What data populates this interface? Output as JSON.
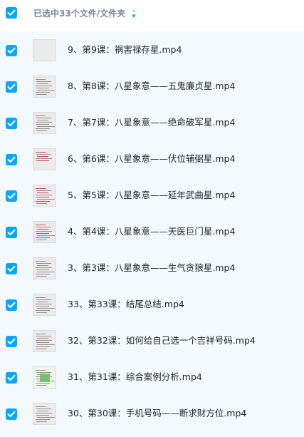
{
  "header": {
    "selected_text": "已选中33个文件/文件夹",
    "sort_icon": "sort-icon",
    "select_all_checked": true
  },
  "colors": {
    "accent": "#06a7ff",
    "list_background": "#f4f9ff",
    "text": "#1f2329",
    "muted": "#7e8693"
  },
  "files": [
    {
      "name": "9、第9课：祸害禄存星.mp4",
      "checked": true,
      "thumb": "blank"
    },
    {
      "name": "8、第8课：八星象意——五鬼廉贞星.mp4",
      "checked": true,
      "thumb": "text"
    },
    {
      "name": "7、第7课：八星象意——绝命破军星.mp4",
      "checked": true,
      "thumb": "text"
    },
    {
      "name": "6、第6课：八星象意——伏位辅弼星.mp4",
      "checked": true,
      "thumb": "red"
    },
    {
      "name": "5、第5课：八星象意——延年武曲星.mp4",
      "checked": true,
      "thumb": "red-text"
    },
    {
      "name": "4、第4课：八星象意——天医巨门星.mp4",
      "checked": true,
      "thumb": "red-text"
    },
    {
      "name": "3、第3课：八星象意——生气贪狼星.mp4",
      "checked": true,
      "thumb": "text"
    },
    {
      "name": "33、第33课：结尾总结.mp4",
      "checked": true,
      "thumb": "text"
    },
    {
      "name": "32、第32课：如何给自己选一个吉祥号码.mp4",
      "checked": true,
      "thumb": "text"
    },
    {
      "name": "31、第31课：综合案例分析.mp4",
      "checked": true,
      "thumb": "diagram"
    },
    {
      "name": "30、第30课：手机号码——断求财方位.mp4",
      "checked": true,
      "thumb": "text"
    }
  ]
}
